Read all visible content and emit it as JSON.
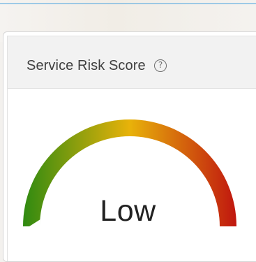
{
  "card": {
    "title": "Service Risk Score",
    "help_icon": "question-circle-icon",
    "help_glyph": "?"
  },
  "gauge": {
    "level_label": "Low",
    "value_fraction": 0.0,
    "colors": {
      "low": "#2f8a11",
      "mid": "#e8b20a",
      "high": "#c0160f"
    }
  }
}
